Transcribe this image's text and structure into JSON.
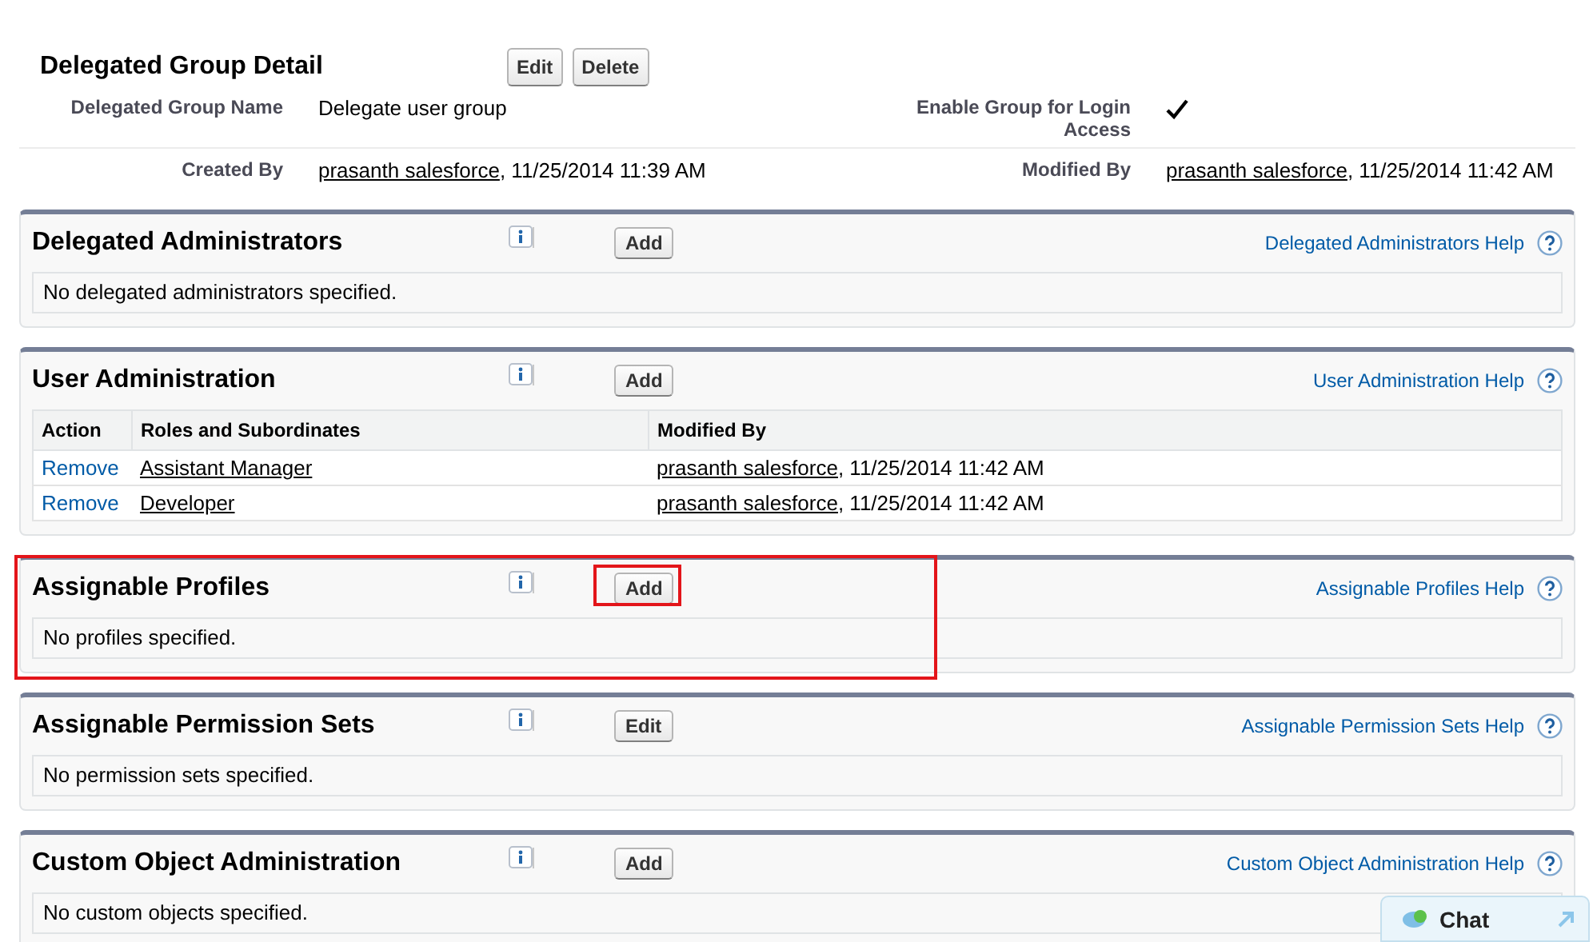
{
  "detail": {
    "title": "Delegated Group Detail",
    "buttons": [
      "Edit",
      "Delete"
    ],
    "rows": [
      [
        {
          "label": "Delegated Group Name",
          "kind": "text",
          "value": "Delegate user group"
        },
        {
          "label": "Enable Group for Login Access",
          "kind": "checkbox",
          "checked": true
        }
      ],
      [
        {
          "label": "Created By",
          "kind": "user",
          "user": "prasanth salesforce",
          "date": ", 11/25/2014 11:39 AM"
        },
        {
          "label": "Modified By",
          "kind": "user",
          "user": "prasanth salesforce",
          "date": ", 11/25/2014 11:42 AM"
        }
      ]
    ]
  },
  "sections": [
    {
      "title": "Delegated Administrators",
      "button": "Add",
      "help": "Delegated Administrators Help",
      "highlighted": false,
      "button_highlighted": false,
      "empty": "No delegated administrators specified."
    },
    {
      "title": "User Administration",
      "button": "Add",
      "help": "User Administration Help",
      "highlighted": false,
      "button_highlighted": false,
      "table": {
        "columns": [
          "Action",
          "Roles and Subordinates",
          "Modified By"
        ],
        "rows": [
          {
            "action": "Remove",
            "role": "Assistant Manager",
            "user": "prasanth salesforce",
            "date": ", 11/25/2014 11:42 AM"
          },
          {
            "action": "Remove",
            "role": "Developer",
            "user": "prasanth salesforce",
            "date": ", 11/25/2014 11:42 AM"
          }
        ]
      }
    },
    {
      "title": "Assignable Profiles",
      "button": "Add",
      "help": "Assignable Profiles Help",
      "highlighted": true,
      "button_highlighted": true,
      "empty": "No profiles specified."
    },
    {
      "title": "Assignable Permission Sets",
      "button": "Edit",
      "help": "Assignable Permission Sets Help",
      "highlighted": false,
      "button_highlighted": false,
      "empty": "No permission sets specified."
    },
    {
      "title": "Custom Object Administration",
      "button": "Add",
      "help": "Custom Object Administration Help",
      "highlighted": false,
      "button_highlighted": false,
      "empty": "No custom objects specified."
    }
  ],
  "chat": {
    "label": "Chat"
  }
}
